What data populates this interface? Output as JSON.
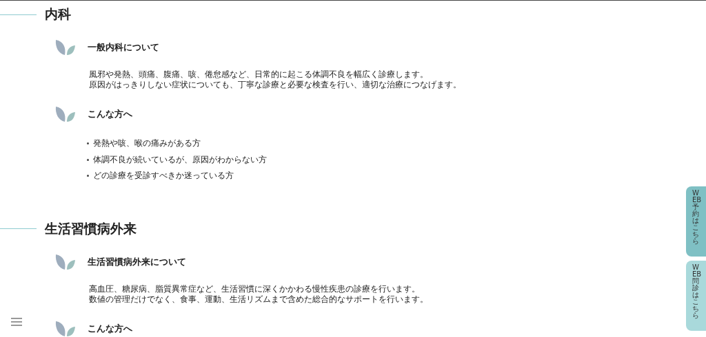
{
  "sections": [
    {
      "title": "内科",
      "blocks": [
        {
          "heading": "一般内科について",
          "kind": "paragraph",
          "lines": [
            "風邪や発熱、頭痛、腹痛、咳、倦怠感など、日常的に起こる体調不良を幅広く診療します。",
            "原因がはっきりしない症状についても、丁寧な診療と必要な検査を行い、適切な治療につなげます。"
          ]
        },
        {
          "heading": "こんな方へ",
          "kind": "list",
          "items": [
            "発熱や咳、喉の痛みがある方",
            "体調不良が続いているが、原因がわからない方",
            "どの診療を受診すべきか迷っている方"
          ]
        }
      ]
    },
    {
      "title": "生活習慣病外来",
      "blocks": [
        {
          "heading": "生活習慣病外来について",
          "kind": "paragraph",
          "lines": [
            "高血圧、糖尿病、脂質異常症など、生活習慣に深くかかわる慢性疾患の診療を行います。",
            "数値の管理だけでなく、食事、運動、生活リズムまで含めた総合的なサポートを行います。"
          ]
        },
        {
          "heading": "こんな方へ",
          "kind": "list"
        }
      ]
    }
  ],
  "side_tabs": [
    {
      "label": "WEB予約はこちら",
      "color": "#7fc0c4"
    },
    {
      "label": "WEB問診はこちら",
      "color": "#a9d9db"
    }
  ]
}
